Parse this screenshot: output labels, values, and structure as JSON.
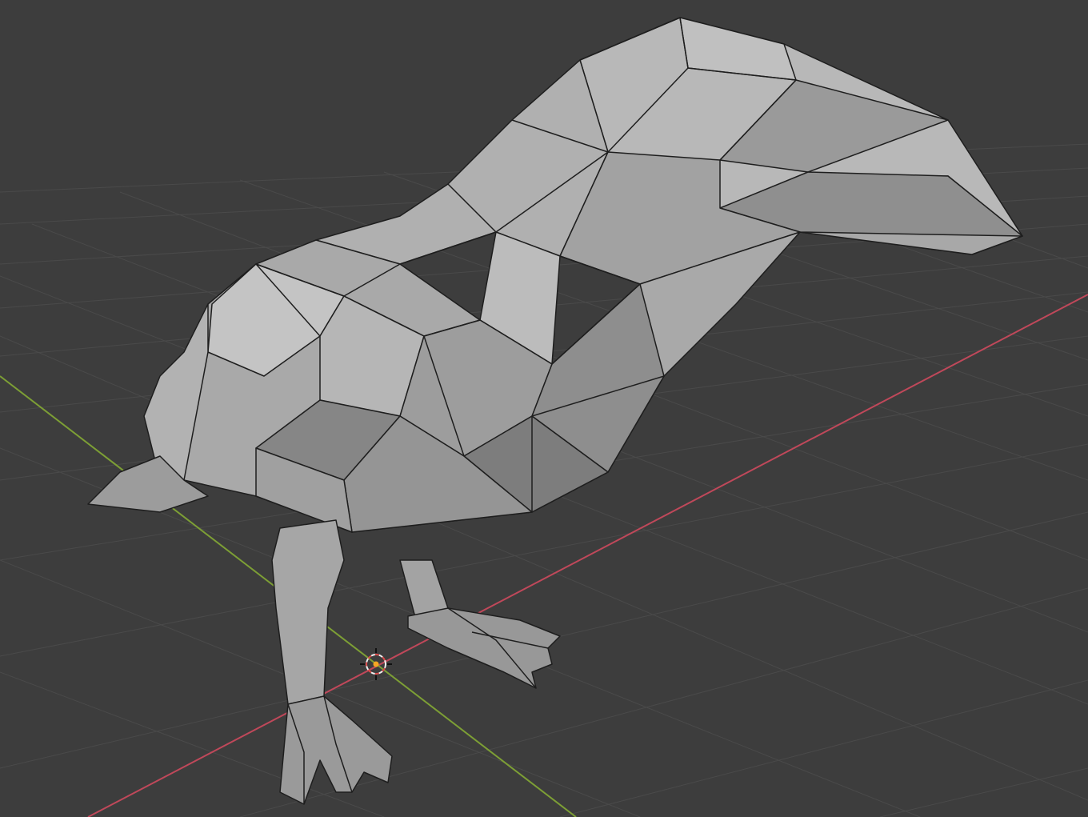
{
  "viewport": {
    "background_color": "#3d3d3d",
    "grid_color": "#4a4a4a",
    "x_axis_color": "#c0485a",
    "y_axis_color": "#7d9f35",
    "mesh_fill_light": "#b4b4b4",
    "mesh_fill_mid": "#9e9e9e",
    "mesh_fill_dark": "#7a7a7a",
    "mesh_edge_color": "#1e1e1e",
    "cursor_color_primary": "#d94b4b",
    "cursor_color_secondary": "#f0f0f0",
    "origin_dot_color": "#f5a623"
  },
  "scene": {
    "object": "low-poly-bird-mesh",
    "icons": {
      "cursor": "3d-cursor-icon",
      "origin": "object-origin-icon"
    }
  }
}
